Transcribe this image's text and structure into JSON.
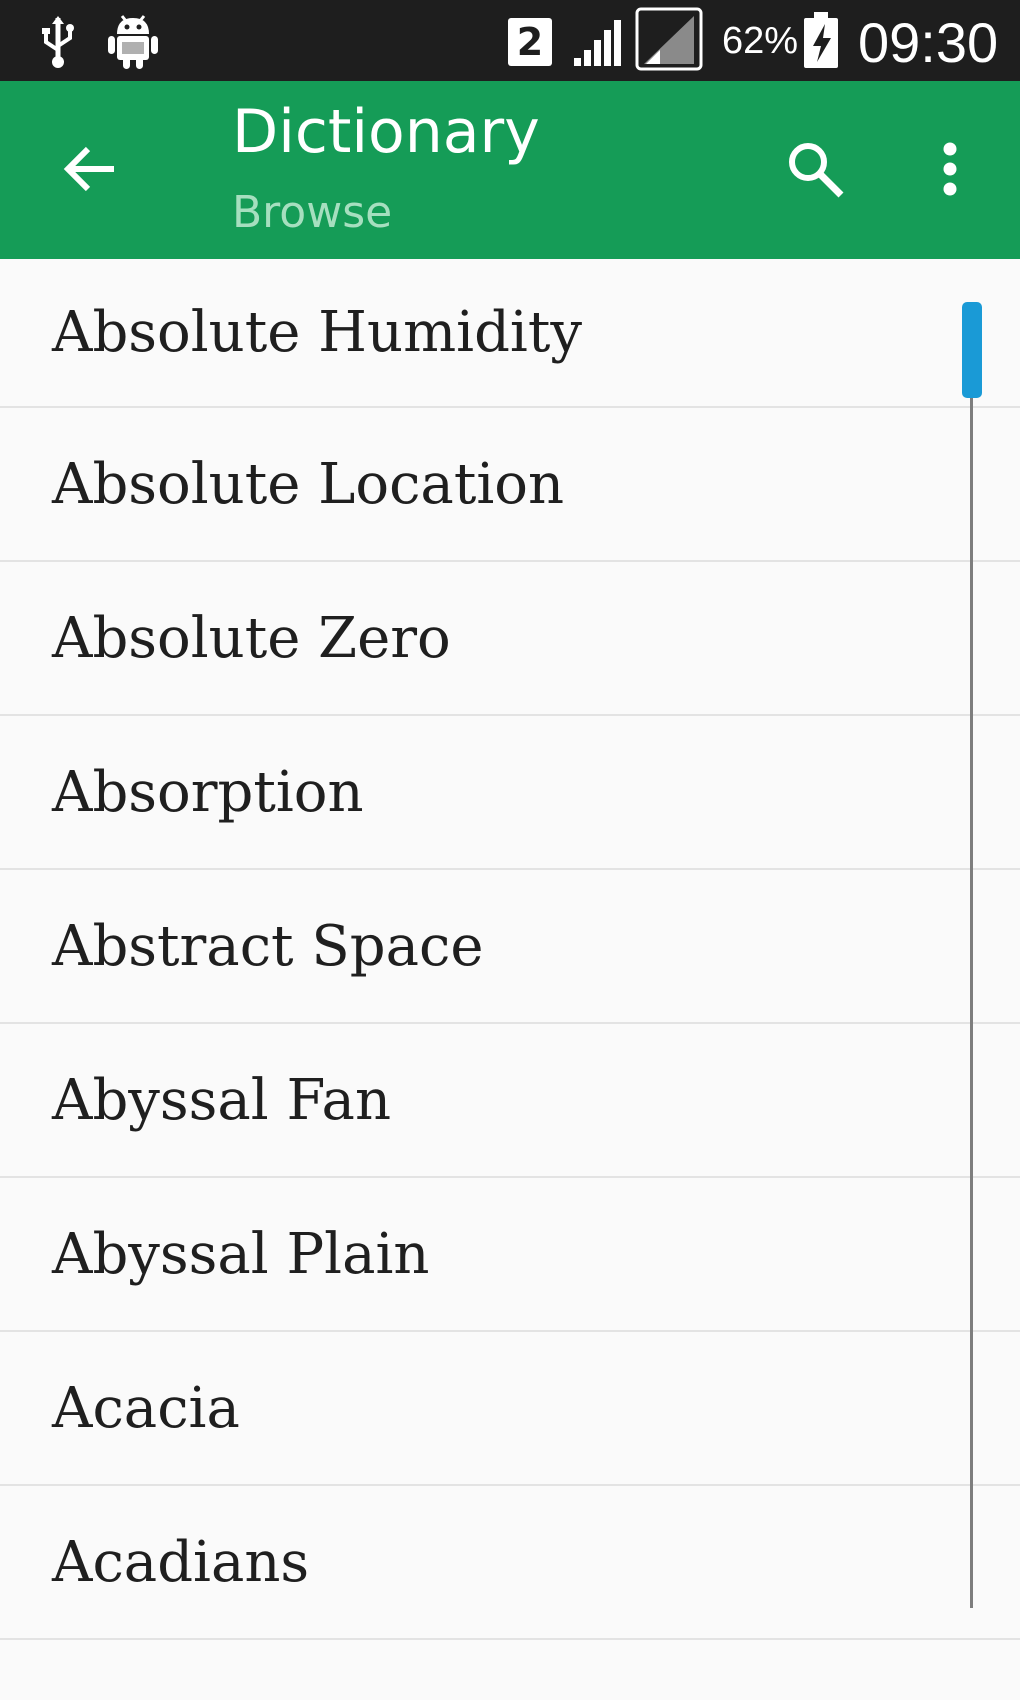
{
  "status_bar": {
    "icons": [
      "usb-icon",
      "android-debug-icon",
      "sim-2-icon",
      "signal-icon",
      "signal-empty-icon",
      "battery-charging-icon"
    ],
    "sim_label": "2",
    "battery_percent": "62%",
    "time": "09:30"
  },
  "app_bar": {
    "title": "Dictionary",
    "subtitle": "Browse",
    "icons": [
      "back-arrow-icon",
      "search-icon",
      "overflow-menu-icon"
    ],
    "color": "#159c57"
  },
  "list": {
    "items": [
      "Absolute Humidity",
      "Absolute Location",
      "Absolute Zero",
      "Absorption",
      "Abstract Space",
      "Abyssal Fan",
      "Abyssal Plain",
      "Acacia",
      "Acadians"
    ]
  },
  "scrollbar": {
    "thumb_color": "#1a9ad6",
    "scroll_position": 0
  }
}
